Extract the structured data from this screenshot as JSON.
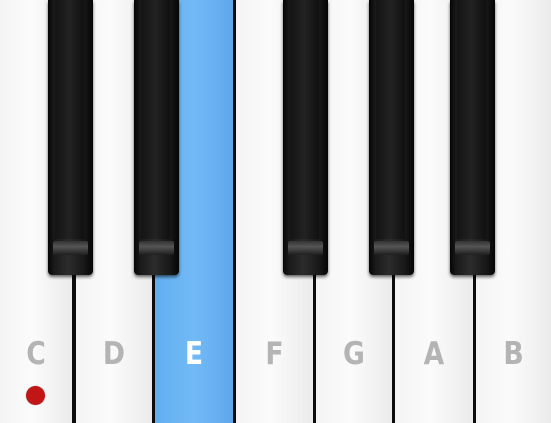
{
  "keyboard": {
    "white_keys": [
      {
        "note": "C",
        "active": false,
        "marked": true
      },
      {
        "note": "D",
        "active": false,
        "marked": false
      },
      {
        "note": "E",
        "active": true,
        "marked": false
      },
      {
        "note": "F",
        "active": false,
        "marked": false
      },
      {
        "note": "G",
        "active": false,
        "marked": false
      },
      {
        "note": "A",
        "active": false,
        "marked": false
      },
      {
        "note": "B",
        "active": false,
        "marked": false
      }
    ],
    "colors": {
      "active_key": "#6cb4f4",
      "marker_dot": "#c01616",
      "label": "#b4b4b4",
      "active_label": "#ffffff"
    }
  }
}
